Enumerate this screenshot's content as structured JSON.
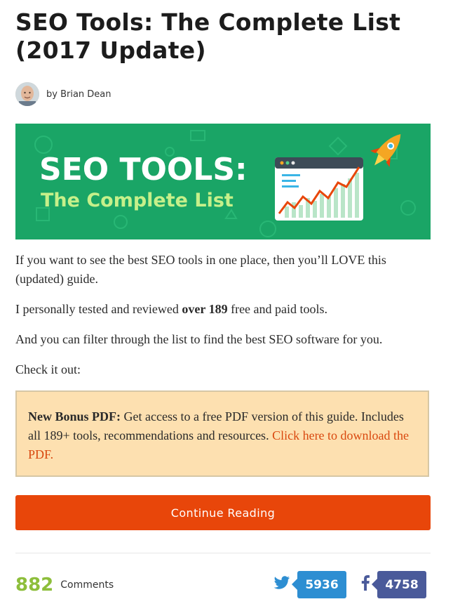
{
  "article": {
    "title": "SEO Tools: The Complete List (2017 Update)",
    "author": "by Brian Dean"
  },
  "hero": {
    "line1": "SEO TOOLS:",
    "line2": "The Complete List",
    "bg_color": "#1aa566",
    "accent_color": "#f5a623"
  },
  "intro": {
    "p1": "If you want to see the best SEO tools in one place, then you’ll LOVE this (updated) guide.",
    "p2_before": "I personally tested and reviewed ",
    "p2_bold": "over 189",
    "p2_after": " free and paid tools.",
    "p3": "And you can filter through the list to find the best SEO software for you.",
    "p4": "Check it out:"
  },
  "bonus": {
    "lead": "New Bonus PDF:",
    "text": " Get access to a free PDF version of this guide. Includes all 189+ tools, recommendations and resources. ",
    "link": "Click here to download the PDF."
  },
  "cta": {
    "label": "Continue Reading",
    "color": "#e8460a"
  },
  "footer": {
    "comment_count": "882",
    "comment_label": "Comments",
    "twitter_count": "5936",
    "facebook_count": "4758",
    "twitter_icon": "twitter-bird-icon",
    "facebook_icon": "facebook-f-icon"
  }
}
